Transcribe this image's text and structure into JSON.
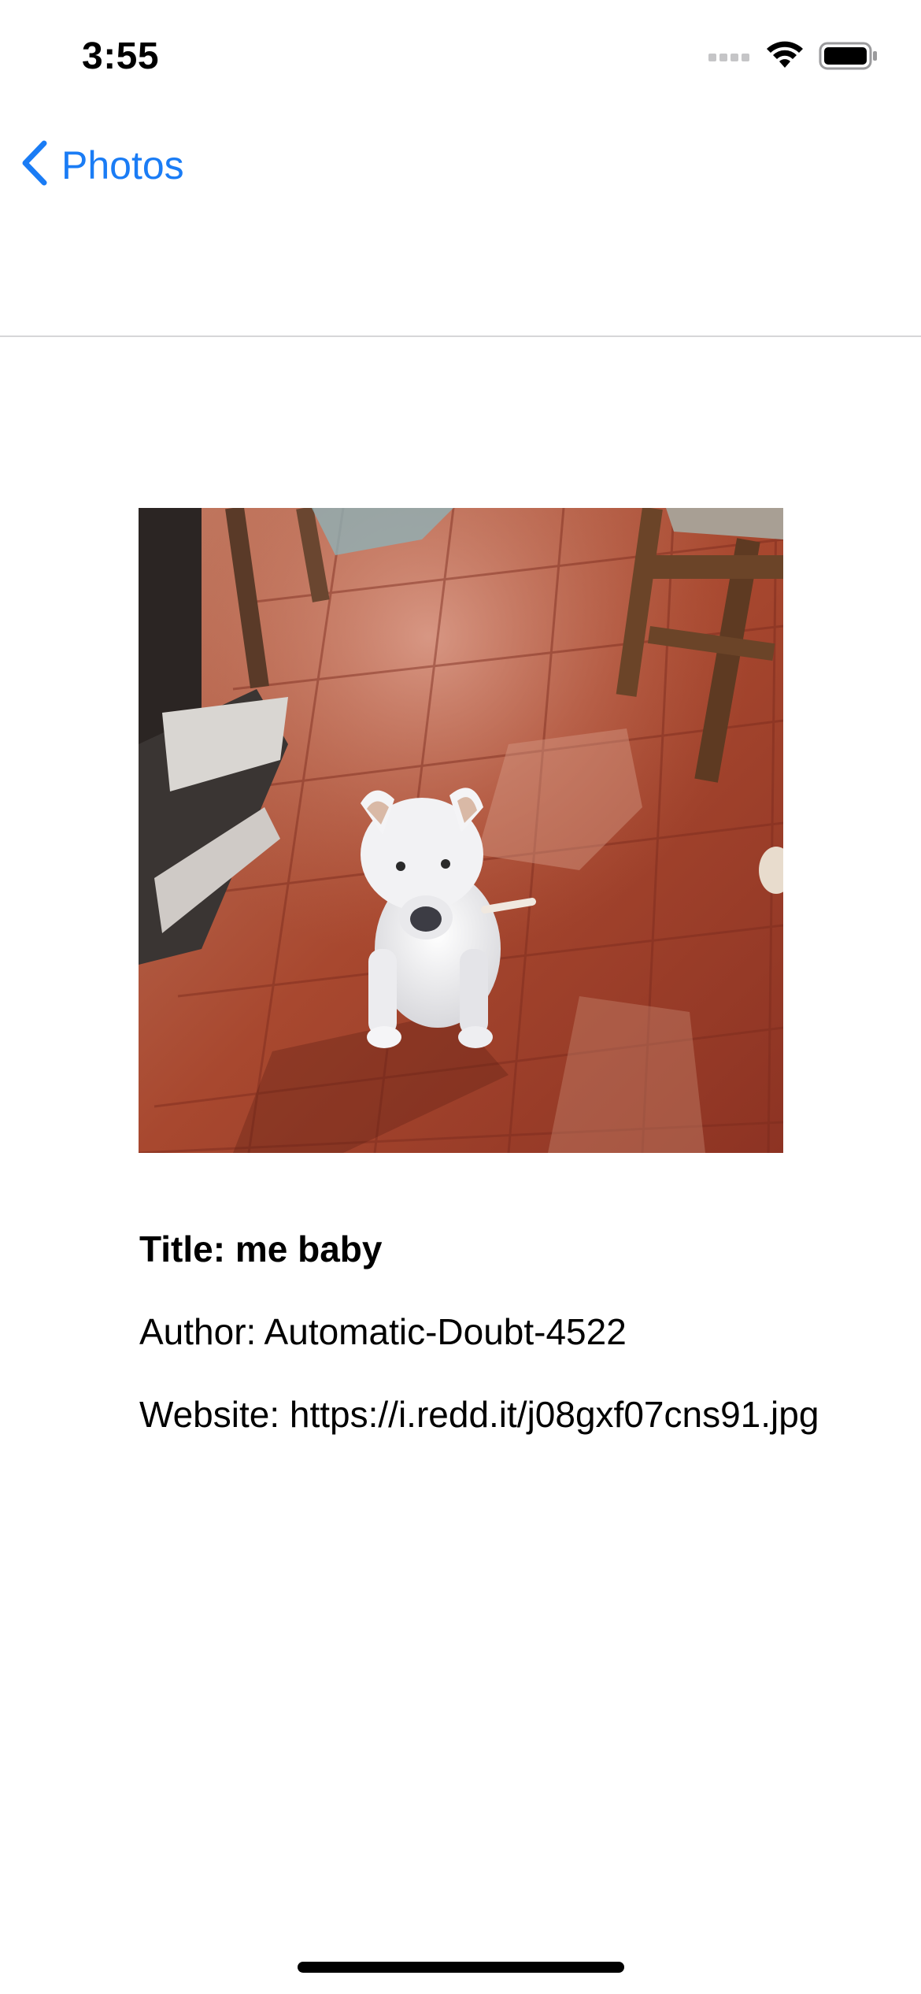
{
  "status_bar": {
    "time": "3:55",
    "signal_icon": "cellular-signal-icon",
    "wifi_icon": "wifi-icon",
    "battery_icon": "battery-icon"
  },
  "nav": {
    "back_icon": "chevron-left-icon",
    "back_label": "Photos",
    "accent_color": "#1a7cf5"
  },
  "photo": {
    "subject": "photo-image"
  },
  "details": {
    "title": "Title: me baby",
    "author": "Author: Automatic-Doubt-4522",
    "website": "Website: https://i.redd.it/j08gxf07cns91.jpg"
  }
}
